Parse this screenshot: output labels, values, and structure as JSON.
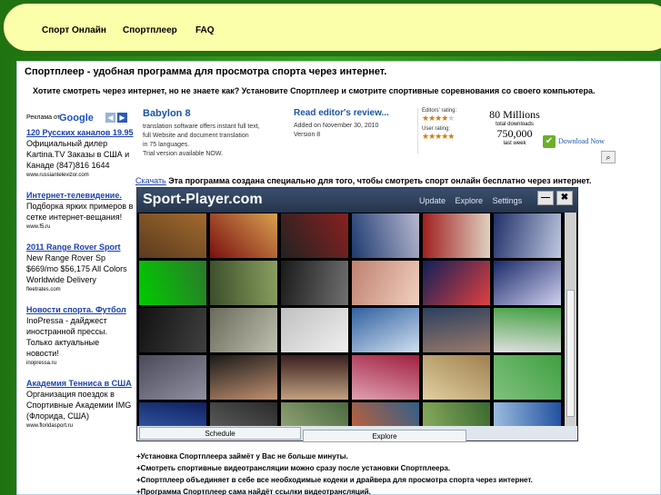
{
  "nav": [
    "Спорт Онлайн",
    "Спортплеер",
    "FAQ"
  ],
  "heading": "Спортплеер - удобная программа для просмотра спорта через интернет.",
  "subheading": "Хотите смотреть через интернет, но не знаете как? Установите Спортплеер и смотрите спортивные соревнования со своего компьютера.",
  "ads_label": "Реклама от",
  "ads_google": "Google",
  "ads": [
    {
      "title": "120 Русских каналов 19.95",
      "body": "Официальный дилер Kartina.TV Заказы в США и Канаде (847)816 1644",
      "url": "www.russiantelevizor.com"
    },
    {
      "title": "Интернет-телевидение.",
      "body": "Подборка ярких примеров в сетке интернет-вещания!",
      "url": "www.f5.ru"
    },
    {
      "title": "2011 Range Rover Sport",
      "body": "New Range Rover Sp $669/mo $56,175 All Colors Worldwide Delivery",
      "url": "fleetrates.com"
    },
    {
      "title": "Новости спорта. Футбол",
      "body": "InoPressa - дайджест иностранной прессы. Только актуальные новости!",
      "url": "inopressa.ru"
    },
    {
      "title": "Академия Тенниса в США",
      "body": "Организация поездок в Спортивные Академии IMG (Флорида, США)",
      "url": "www.floridasport.ru"
    }
  ],
  "banner": {
    "product": "Babylon 8",
    "desc": [
      "translation software offers instant full text,",
      "full Website and document translation",
      "in 75 languages.",
      "Trial version available NOW."
    ],
    "review_title": "Read editor's review...",
    "added": "Added on November 30, 2010",
    "version": "Version 8",
    "editors_label": "Editors' rating:",
    "user_label": "User rating:",
    "editors_stars": 4,
    "user_stars": 5,
    "millions": "80 Millions",
    "total_label": "total downloads",
    "week_num": "750,000",
    "week_label": "last week",
    "download": "Download Now"
  },
  "intro_link": "Скачать",
  "intro_text": " Эта программа создана специально для того, чтобы смотреть спорт онлайн бесплатно через интернет.",
  "app": {
    "title": "Sport-Player.com",
    "menu": [
      "Update",
      "Explore",
      "Settings"
    ],
    "min": "—",
    "close": "✖",
    "tab_schedule": "Schedule",
    "tab_explore": "Explore"
  },
  "features": [
    "+Установка Спортплеера займёт у Вас не больше минуты.",
    "+Смотреть спортивные видеотрансляции можно сразу после установки Спортплеера.",
    "+Спортплеер объединяет в себе все необходимые кодеки и драйвера для просмотра спорта через интернет.",
    "+Программа Спортплеер сама найдёт ссылки видеотрансляций."
  ]
}
